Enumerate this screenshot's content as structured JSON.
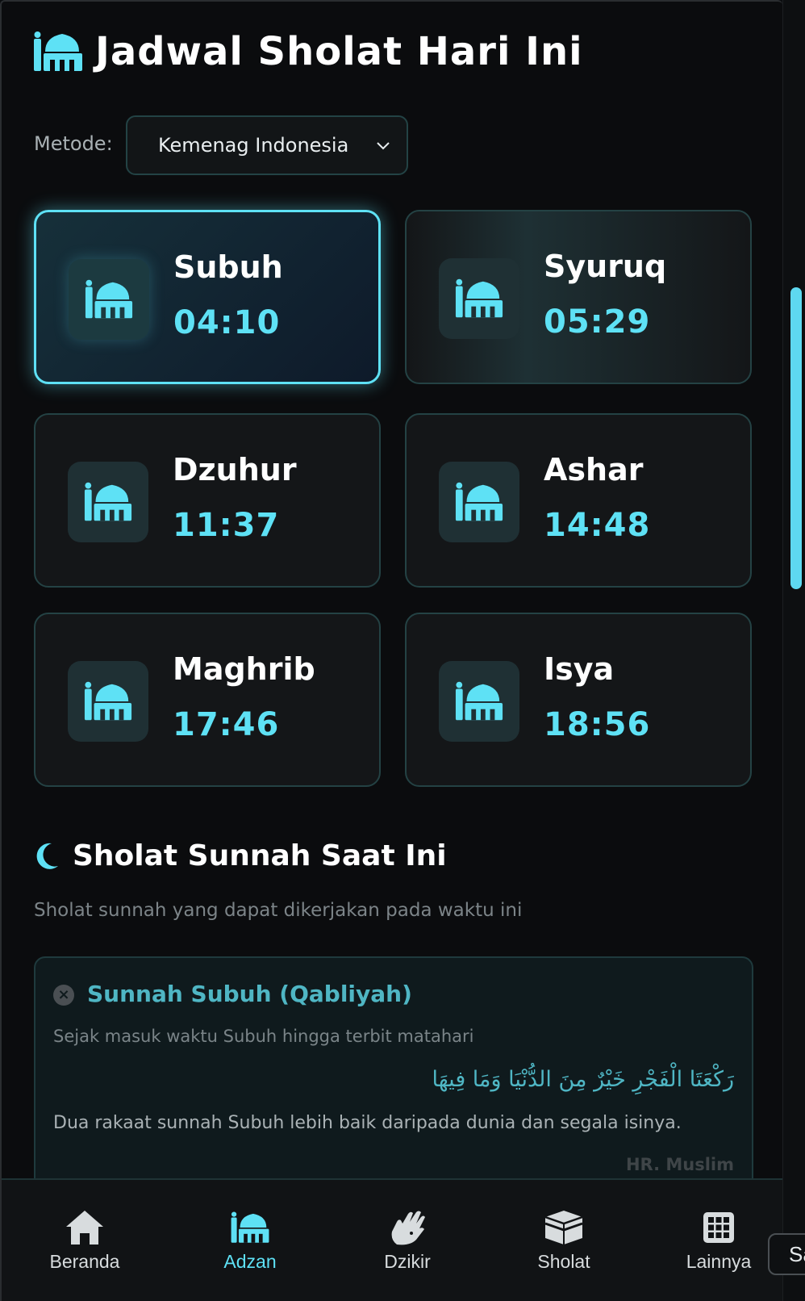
{
  "header": {
    "title": "Jadwal Sholat Hari Ini",
    "icon": "mosque-icon"
  },
  "metode": {
    "label": "Metode:",
    "selected": "Kemenag Indonesia"
  },
  "prayers": [
    {
      "name": "Subuh",
      "time": "04:10",
      "state": "active"
    },
    {
      "name": "Syuruq",
      "time": "05:29",
      "state": "near"
    },
    {
      "name": "Dzuhur",
      "time": "11:37",
      "state": "normal"
    },
    {
      "name": "Ashar",
      "time": "14:48",
      "state": "normal"
    },
    {
      "name": "Maghrib",
      "time": "17:46",
      "state": "normal"
    },
    {
      "name": "Isya",
      "time": "18:56",
      "state": "normal"
    }
  ],
  "sunnah_section": {
    "title": "Sholat Sunnah Saat Ini",
    "subtitle": "Sholat sunnah yang dapat dikerjakan pada waktu ini",
    "icon": "moon-icon",
    "card": {
      "title": "Sunnah Subuh (Qabliyah)",
      "time_range": "Sejak masuk waktu Subuh hingga terbit matahari",
      "arabic": "رَكْعَتَا الْفَجْرِ خَيْرٌ مِنَ الدُّنْيَا وَمَا فِيهَا",
      "description": "Dua rakaat sunnah Subuh lebih baik daripada dunia dan segala isinya.",
      "source": "HR. Muslim",
      "status_icon": "close-icon"
    }
  },
  "nav": {
    "items": [
      {
        "label": "Beranda",
        "icon": "home-icon"
      },
      {
        "label": "Adzan",
        "icon": "mosque-icon",
        "active": true
      },
      {
        "label": "Dzikir",
        "icon": "hand-icon"
      },
      {
        "label": "Sholat",
        "icon": "kaaba-icon"
      },
      {
        "label": "Lainnya",
        "icon": "grid-icon"
      }
    ]
  },
  "extra_button": {
    "label": "Sa"
  },
  "colors": {
    "accent": "#5ee1f5",
    "background": "#0b0c0e",
    "card": "#141618"
  }
}
